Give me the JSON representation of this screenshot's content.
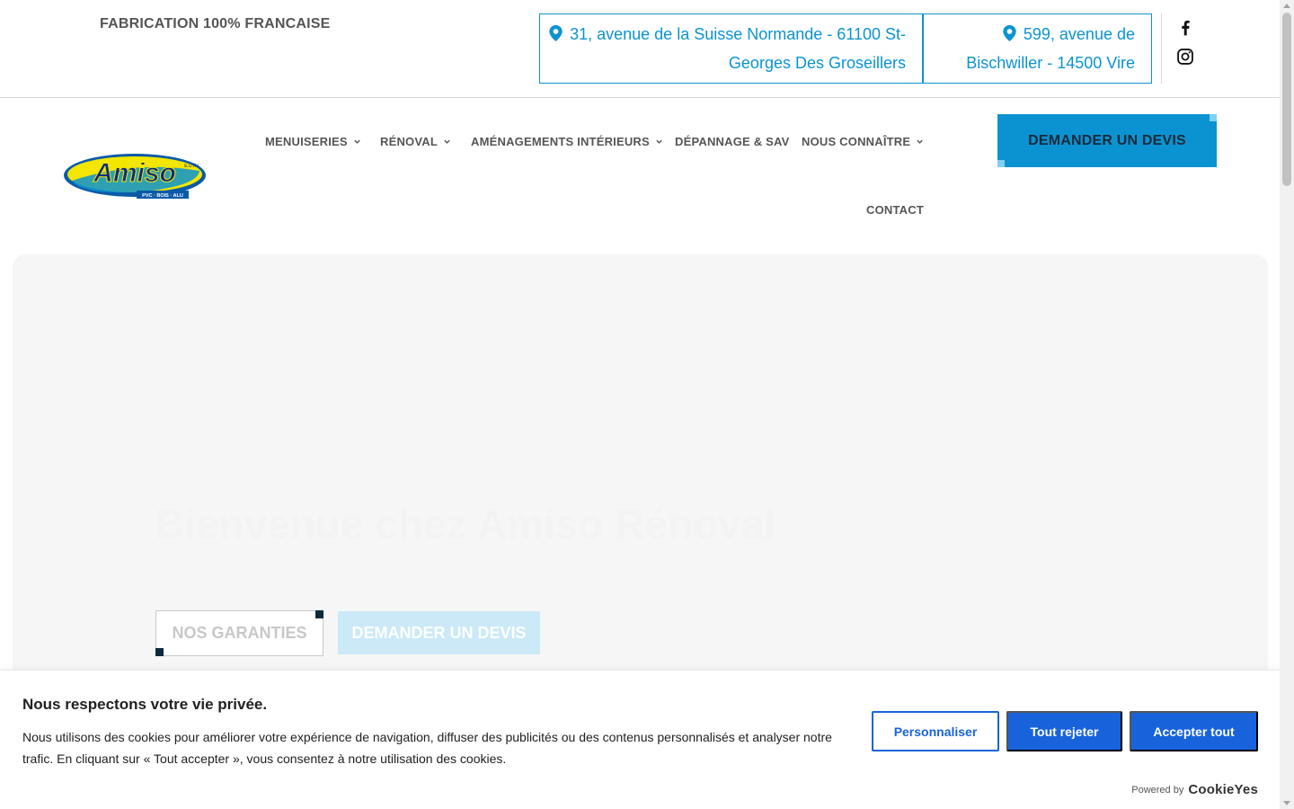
{
  "topbar": {
    "tagline": "FABRICATION 100% FRANCAISE",
    "address1": "31, avenue de la Suisse Normande - 61100 St-Georges Des Groseillers",
    "address2": "599, avenue de Bischwiller - 14500 Vire"
  },
  "social": {
    "facebook_icon": "facebook-icon",
    "instagram_icon": "instagram-icon"
  },
  "logo": {
    "name": "Amiso",
    "suffix": "E.U.R.L",
    "sub": "PVC · BOIS · ALU"
  },
  "nav": {
    "menuiseries": "MENUISERIES",
    "renoval": "RÉNOVAL",
    "amenagements": "AMÉNAGEMENTS INTÉRIEURS",
    "depannage": "DÉPANNAGE & SAV",
    "nous_connaitre": "NOUS CONNAÎTRE",
    "contact": "CONTACT",
    "cta": "DEMANDER UN DEVIS"
  },
  "hero": {
    "title": "Bienvenue chez Amiso Rénoval",
    "btn_guarantees": "NOS GARANTIES",
    "btn_quote": "DEMANDER UN DEVIS"
  },
  "cookie": {
    "title": "Nous respectons votre vie privée.",
    "text": "Nous utilisons des cookies pour améliorer votre expérience de navigation, diffuser des publicités ou des contenus personnalisés et analyser notre trafic. En cliquant sur « Tout accepter », vous consentez à notre utilisation des cookies.",
    "btn_customize": "Personnaliser",
    "btn_reject": "Tout rejeter",
    "btn_accept": "Accepter tout",
    "powered_by": "Powered by",
    "brand": "CookieYes"
  },
  "colors": {
    "accent": "#0b93d1",
    "cookie_blue": "#1863dc",
    "dark_square": "#0d2a3d"
  }
}
